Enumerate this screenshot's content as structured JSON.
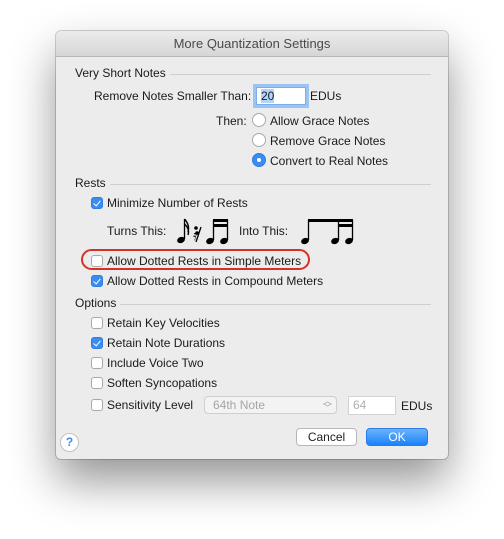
{
  "window": {
    "title": "More Quantization Settings"
  },
  "very_short_notes": {
    "heading": "Very Short Notes",
    "remove_label": "Remove Notes Smaller Than:",
    "remove_value": "20",
    "remove_unit": "EDUs",
    "then_label": "Then:",
    "options": [
      {
        "label": "Allow Grace Notes",
        "selected": false
      },
      {
        "label": "Remove Grace Notes",
        "selected": false
      },
      {
        "label": "Convert to Real Notes",
        "selected": true
      }
    ]
  },
  "rests": {
    "heading": "Rests",
    "minimize": {
      "label": "Minimize Number of Rests",
      "checked": true
    },
    "turns_this_label": "Turns This:",
    "into_this_label": "Into This:",
    "turns_this_icon": "sixteenth-note-rest-beamed-sixteenths",
    "into_this_icon": "beamed-eighth-and-sixteenths",
    "dotted_simple": {
      "label": "Allow Dotted Rests in Simple Meters",
      "checked": false,
      "highlighted": true,
      "highlight_color": "#d43228"
    },
    "dotted_compound": {
      "label": "Allow Dotted Rests in Compound Meters",
      "checked": true
    }
  },
  "options": {
    "heading": "Options",
    "items": [
      {
        "label": "Retain Key Velocities",
        "checked": false
      },
      {
        "label": "Retain Note Durations",
        "checked": true
      },
      {
        "label": "Include Voice Two",
        "checked": false
      },
      {
        "label": "Soften Syncopations",
        "checked": false
      }
    ],
    "sensitivity": {
      "label": "Sensitivity Level",
      "checked": false,
      "popup_value": "64th Note",
      "value": "64",
      "unit": "EDUs"
    }
  },
  "buttons": {
    "cancel": "Cancel",
    "ok": "OK",
    "help": "?"
  },
  "colors": {
    "accent": "#3b8cf2",
    "highlight": "#d43228",
    "window_bg": "#ececec"
  }
}
